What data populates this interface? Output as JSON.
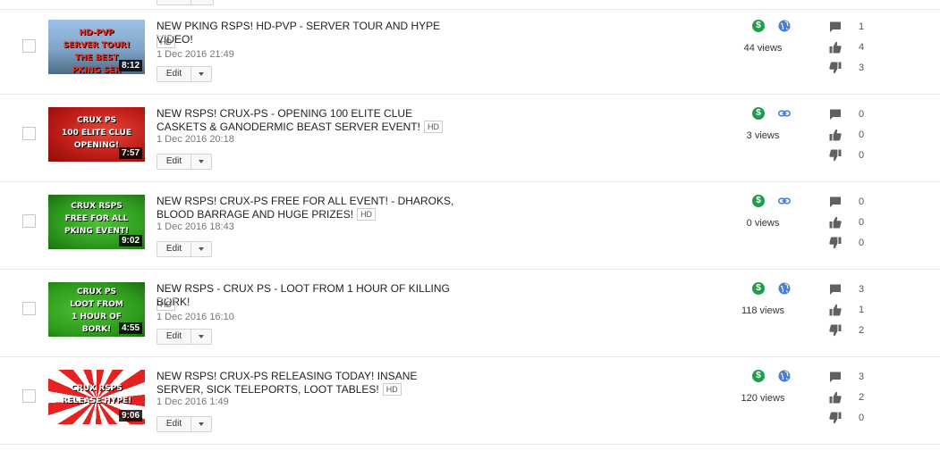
{
  "edit_label": "Edit",
  "hd_label": "HD",
  "colors": {
    "monetized": "#1e9e4a",
    "visibility": "#4a7fd6",
    "stat_icon": "#606060"
  },
  "videos": [
    {
      "title": "NEW PKING RSPS! HD-PVP - SERVER TOUR AND HYPE VIDEO!",
      "date": "1 Dec 2016 21:49",
      "duration": "8:12",
      "thumb_text": "HD-PVP\nSERVER TOUR!\nTHE BEST\nPKING SER",
      "visibility": "public",
      "visibility_icon": "globe-icon",
      "views": "44 views",
      "comments": "1",
      "likes": "4",
      "dislikes": "3"
    },
    {
      "title": "NEW RSPS! CRUX-PS - OPENING 100 ELITE CLUE CASKETS & GANODERMIC BEAST SERVER EVENT!",
      "date": "1 Dec 2016 20:18",
      "duration": "7:57",
      "thumb_text": "CRUX PS\n100 ELITE CLUE\nOPENING!",
      "visibility": "unlisted",
      "visibility_icon": "link-icon",
      "views": "3 views",
      "comments": "0",
      "likes": "0",
      "dislikes": "0"
    },
    {
      "title": "NEW RSPS! CRUX-PS FREE FOR ALL EVENT! - DHAROKS, BLOOD BARRAGE AND HUGE PRIZES!",
      "date": "1 Dec 2016 18:43",
      "duration": "9:02",
      "thumb_text": "CRUX RSPS\nFREE FOR ALL\nPKING EVENT!",
      "visibility": "unlisted",
      "visibility_icon": "link-icon",
      "views": "0 views",
      "comments": "0",
      "likes": "0",
      "dislikes": "0"
    },
    {
      "title": "NEW RSPS - CRUX PS - LOOT FROM 1 HOUR OF KILLING BORK!",
      "date": "1 Dec 2016 16:10",
      "duration": "4:55",
      "thumb_text": "CRUX PS\nLOOT FROM\n1 HOUR OF\nBORK!",
      "visibility": "public",
      "visibility_icon": "globe-icon",
      "views": "118 views",
      "comments": "3",
      "likes": "1",
      "dislikes": "2"
    },
    {
      "title": "NEW RSPS! CRUX-PS RELEASING TODAY! INSANE SERVER, SICK TELEPORTS, LOOT TABLES!",
      "date": "1 Dec 2016 1:49",
      "duration": "9:06",
      "thumb_text": "CRUX RSPS\nRELEASE HYPE!",
      "visibility": "public",
      "visibility_icon": "globe-icon",
      "views": "120 views",
      "comments": "3",
      "likes": "2",
      "dislikes": "0"
    }
  ]
}
